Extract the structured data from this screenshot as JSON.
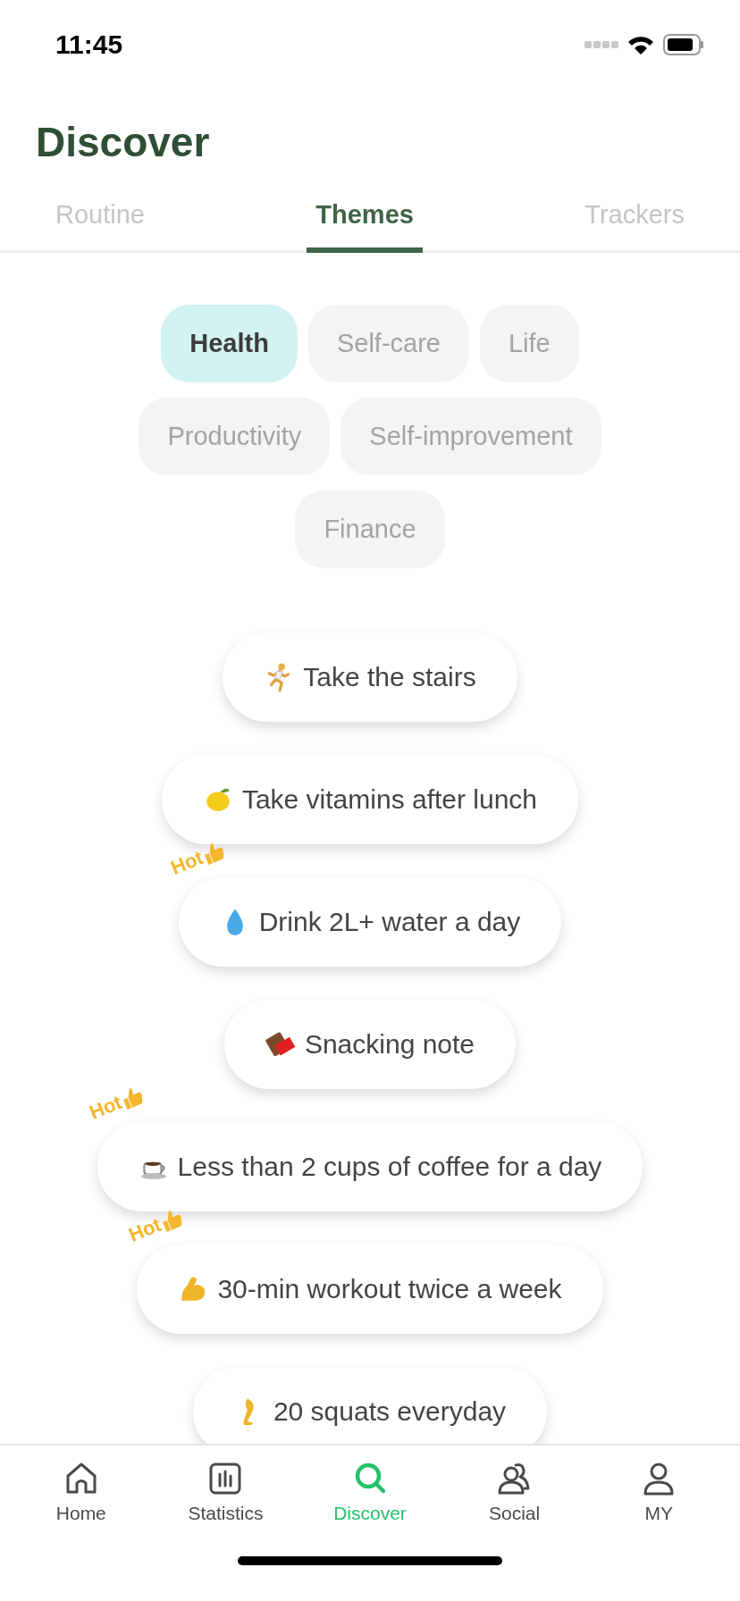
{
  "status_bar": {
    "time": "11:45"
  },
  "title": "Discover",
  "tabs": [
    {
      "label": "Routine",
      "selected": false
    },
    {
      "label": "Themes",
      "selected": true
    },
    {
      "label": "Trackers",
      "selected": false
    }
  ],
  "chip_rows": [
    [
      {
        "label": "Health",
        "selected": true
      },
      {
        "label": "Self-care",
        "selected": false
      },
      {
        "label": "Life",
        "selected": false
      }
    ],
    [
      {
        "label": "Productivity",
        "selected": false
      },
      {
        "label": "Self-improvement",
        "selected": false
      }
    ],
    [
      {
        "label": "Finance",
        "selected": false
      }
    ]
  ],
  "habits": [
    {
      "label": "Take the stairs"
    },
    {
      "label": "Take vitamins after lunch"
    },
    {
      "label": "Drink 2L+ water a day",
      "badge": "Hot"
    },
    {
      "label": "Snacking note"
    },
    {
      "label": "Less than 2 cups of coffee for a day",
      "badge": "Hot"
    },
    {
      "label": "30-min workout twice a week",
      "badge": "Hot"
    },
    {
      "label": "20 squats everyday"
    }
  ],
  "nav": [
    {
      "label": "Home",
      "selected": false
    },
    {
      "label": "Statistics",
      "selected": false
    },
    {
      "label": "Discover",
      "selected": true
    },
    {
      "label": "Social",
      "selected": false
    },
    {
      "label": "MY",
      "selected": false
    }
  ]
}
